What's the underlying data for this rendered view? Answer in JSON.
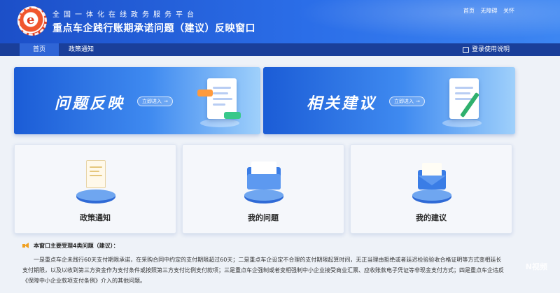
{
  "header": {
    "subtitle": "全国一体化在线政务服务平台",
    "title": "重点车企践行账期承诺问题（建议）反映窗口",
    "top_links": [
      "首页",
      "无障碍",
      "关怀"
    ]
  },
  "nav": {
    "items": [
      {
        "label": "首页"
      },
      {
        "label": "政策通知"
      }
    ],
    "login_label": "登录使用说明"
  },
  "banners": [
    {
      "title": "问题反映",
      "button": "立即进入"
    },
    {
      "title": "相关建议",
      "button": "立即进入"
    }
  ],
  "cards": [
    {
      "label": "政策通知"
    },
    {
      "label": "我的问题"
    },
    {
      "label": "我的建议"
    }
  ],
  "notice": {
    "heading": "本窗口主要受理4类问题（建议）：",
    "body": "一是重点车企未践行60天支付期限承诺，在采购合同中约定的支付期限超过60天；二是重点车企设定不合理的支付期限起算时间，无正当理由拒绝或者延迟检验验收合格证明等方式变相延长支付期限，以及以收到第三方资金作为支付条件或按照第三方支付比例支付款项；三是重点车企强制或者变相强制中小企业接受商业汇票、应收账款电子凭证等非现金支付方式；四是重点车企违反《保障中小企业款项支付条例》介入的其他问题。"
  },
  "watermark": "N视频",
  "colors": {
    "header_start": "#1c4fc8",
    "header_end": "#3d86f2",
    "nav_bg": "#1a3f9a",
    "nav_active": "#2f65d6",
    "card_bg": "#f5f7fb"
  }
}
